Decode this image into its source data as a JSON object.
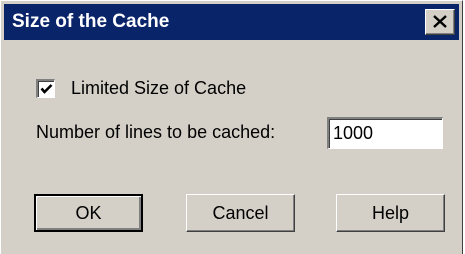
{
  "window": {
    "title": "Size of the Cache",
    "close_icon": "close-x-icon"
  },
  "cache": {
    "limited_label": "Limited Size of Cache",
    "limited_checked": true,
    "lines_label": "Number of lines to be cached:",
    "lines_value": "1000"
  },
  "buttons": {
    "ok": "OK",
    "cancel": "Cancel",
    "help": "Help"
  },
  "colors": {
    "titlebar": "#0a246a",
    "face": "#d4d0c8"
  }
}
